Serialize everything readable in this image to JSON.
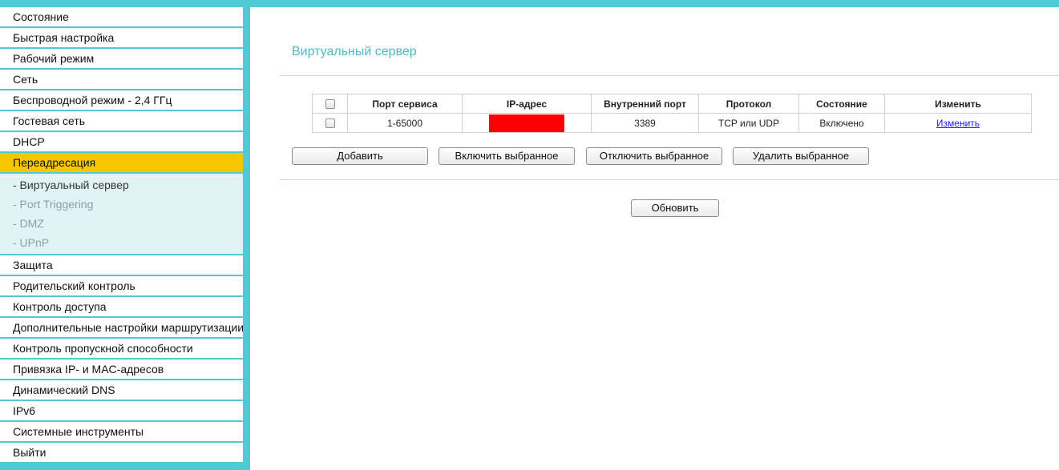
{
  "sidebar": {
    "items_top": [
      {
        "label": "Состояние"
      },
      {
        "label": "Быстрая настройка"
      },
      {
        "label": "Рабочий режим"
      },
      {
        "label": "Сеть"
      },
      {
        "label": "Беспроводной режим - 2,4 ГГц"
      },
      {
        "label": "Гостевая сеть"
      },
      {
        "label": "DHCP"
      }
    ],
    "active_item": {
      "label": "Переадресация"
    },
    "submenu": [
      {
        "label": "- Виртуальный сервер"
      },
      {
        "label": "- Port Triggering"
      },
      {
        "label": "- DMZ"
      },
      {
        "label": "- UPnP"
      }
    ],
    "items_bottom": [
      {
        "label": "Защита"
      },
      {
        "label": "Родительский контроль"
      },
      {
        "label": "Контроль доступа"
      },
      {
        "label": "Дополнительные настройки маршрутизации"
      },
      {
        "label": "Контроль пропускной способности"
      },
      {
        "label": "Привязка IP- и MAC-адресов"
      },
      {
        "label": "Динамический DNS"
      },
      {
        "label": "IPv6"
      },
      {
        "label": "Системные инструменты"
      },
      {
        "label": "Выйти"
      }
    ]
  },
  "main": {
    "title": "Виртуальный сервер",
    "table": {
      "headers": [
        "Порт сервиса",
        "IP-адрес",
        "Внутренний порт",
        "Протокол",
        "Состояние",
        "Изменить"
      ],
      "rows": [
        {
          "service_port": "1-65000",
          "ip": "",
          "internal_port": "3389",
          "protocol": "TCP или UDP",
          "status": "Включено",
          "edit": "Изменить"
        }
      ]
    },
    "buttons": {
      "add": "Добавить",
      "enable_selected": "Включить выбранное",
      "disable_selected": "Отключить выбранное",
      "delete_selected": "Удалить выбранное",
      "refresh": "Обновить"
    }
  },
  "colors": {
    "frame_accent": "#4fcbd6",
    "active_menu": "#f7c600",
    "submenu_bg": "#e0f4f6",
    "title": "#4cb9c6",
    "link": "#1a1aff",
    "redaction": "#ff0000"
  }
}
